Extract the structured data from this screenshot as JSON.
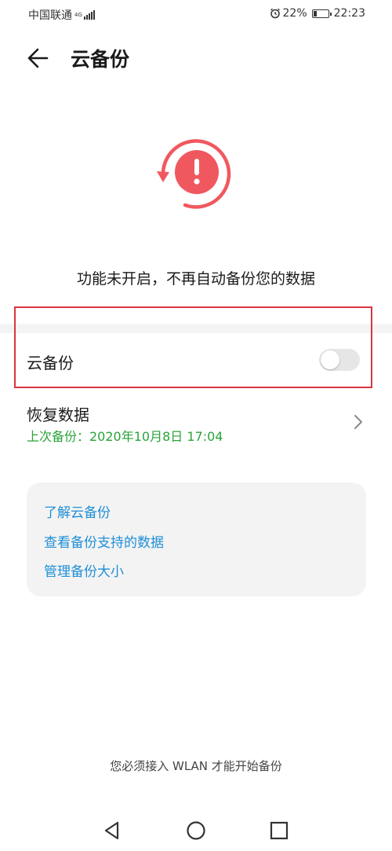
{
  "status_bar": {
    "carrier": "中国联通",
    "network": "4G",
    "battery_percent": "22%",
    "battery_level": 0.22,
    "time": "22:23",
    "icons": [
      "alarm-icon",
      "battery-icon",
      "signal-icon"
    ]
  },
  "header": {
    "title": "云备份",
    "back_icon": "arrow-left-icon"
  },
  "alert": {
    "icon": "exclamation-sync-icon",
    "color": "#f0585f",
    "message": "功能未开启，不再自动备份您的数据"
  },
  "settings": {
    "cloud_backup_label": "云备份",
    "cloud_backup_enabled": false,
    "restore_title": "恢复数据",
    "restore_subtitle": "上次备份：2020年10月8日 17:04",
    "restore_subtitle_color": "#2aa33a"
  },
  "links": [
    {
      "label": "了解云备份"
    },
    {
      "label": "查看备份支持的数据"
    },
    {
      "label": "管理备份大小"
    }
  ],
  "link_color": "#1e8fd8",
  "footer": {
    "note": "您必须接入 WLAN 才能开始备份"
  },
  "nav": {
    "back": "triangle-back-icon",
    "home": "circle-home-icon",
    "recents": "square-recents-icon"
  },
  "highlight_color": "#d9363e"
}
